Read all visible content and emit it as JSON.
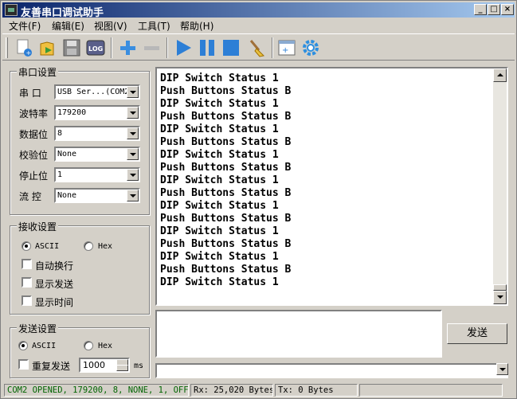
{
  "window": {
    "title": "友善串口调试助手"
  },
  "menu": [
    {
      "label": "文件(F)"
    },
    {
      "label": "编辑(E)"
    },
    {
      "label": "视图(V)"
    },
    {
      "label": "工具(T)"
    },
    {
      "label": "帮助(H)"
    }
  ],
  "toolbar": {
    "buttons": [
      "new-icon",
      "open-icon",
      "save-icon",
      "log-icon",
      "add-icon",
      "remove-icon",
      "play-icon",
      "pause-icon",
      "stop-icon",
      "clear-icon",
      "layout-icon",
      "settings-icon"
    ],
    "log_label": "LOG"
  },
  "serial": {
    "group_title": "串口设置",
    "port_label": "串  口",
    "port_value": "USB Ser...(COM2",
    "baud_label": "波特率",
    "baud_value": "179200",
    "databits_label": "数据位",
    "databits_value": "8",
    "parity_label": "校验位",
    "parity_value": "None",
    "stopbits_label": "停止位",
    "stopbits_value": "1",
    "flow_label": "流  控",
    "flow_value": "None"
  },
  "receive": {
    "group_title": "接收设置",
    "ascii_label": "ASCII",
    "hex_label": "Hex",
    "selected": "ASCII",
    "auto_wrap_label": "自动换行",
    "show_send_label": "显示发送",
    "show_time_label": "显示时间",
    "lines": [
      "DIP Switch Status 1",
      "Push Buttons Status B",
      "DIP Switch Status 1",
      "Push Buttons Status B",
      "DIP Switch Status 1",
      "Push Buttons Status B",
      "DIP Switch Status 1",
      "Push Buttons Status B",
      "DIP Switch Status 1",
      "Push Buttons Status B",
      "DIP Switch Status 1",
      "Push Buttons Status B",
      "DIP Switch Status 1",
      "Push Buttons Status B",
      "DIP Switch Status 1",
      "Push Buttons Status B",
      "DIP Switch Status 1"
    ]
  },
  "send": {
    "group_title": "发送设置",
    "ascii_label": "ASCII",
    "hex_label": "Hex",
    "selected": "ASCII",
    "repeat_label": "重复发送",
    "interval_value": "1000",
    "interval_unit": "ms",
    "send_button": "发送"
  },
  "status": {
    "port_status": "COM2 OPENED, 179200, 8, NONE, 1, OFF",
    "rx": "Rx: 25,020 Bytes",
    "tx": "Tx: 0 Bytes"
  },
  "colors": {
    "accent": "#2d7fd6",
    "title_bar_start": "#0a246a",
    "title_bar_end": "#a6caf0",
    "status_text": "#006400"
  }
}
